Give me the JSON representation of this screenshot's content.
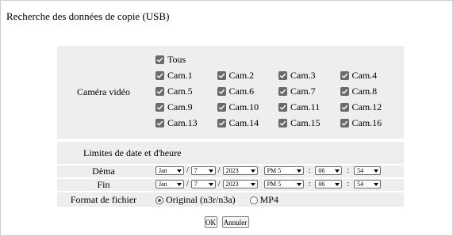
{
  "title": "Recherche des données de copie (USB)",
  "camera": {
    "label": "Caméra vidéo",
    "all_label": "Tous",
    "cameras": [
      "Cam.1",
      "Cam.2",
      "Cam.3",
      "Cam.4",
      "Cam.5",
      "Cam.6",
      "Cam.7",
      "Cam.8",
      "Cam.9",
      "Cam.10",
      "Cam.11",
      "Cam.12",
      "Cam.13",
      "Cam.14",
      "Cam.15",
      "Cam.16"
    ],
    "checked": true
  },
  "date": {
    "section_label": "Limites de date et d'heure",
    "start": {
      "label": "Dèma",
      "month": "Jan",
      "day": "7",
      "year": "2023",
      "hour": "PM 5",
      "minute": "06",
      "second": "54"
    },
    "end": {
      "label": "Fin",
      "month": "Jan",
      "day": "7",
      "year": "2023",
      "hour": "PM 5",
      "minute": "06",
      "second": "54"
    },
    "date_sep": "/",
    "time_sep": ":"
  },
  "format": {
    "label": "Format de fichier",
    "options": [
      {
        "label": "Original (n3r/n3a)",
        "selected": true
      },
      {
        "label": "MP4",
        "selected": false
      }
    ]
  },
  "buttons": {
    "ok": "OK",
    "cancel": "Annuler"
  }
}
